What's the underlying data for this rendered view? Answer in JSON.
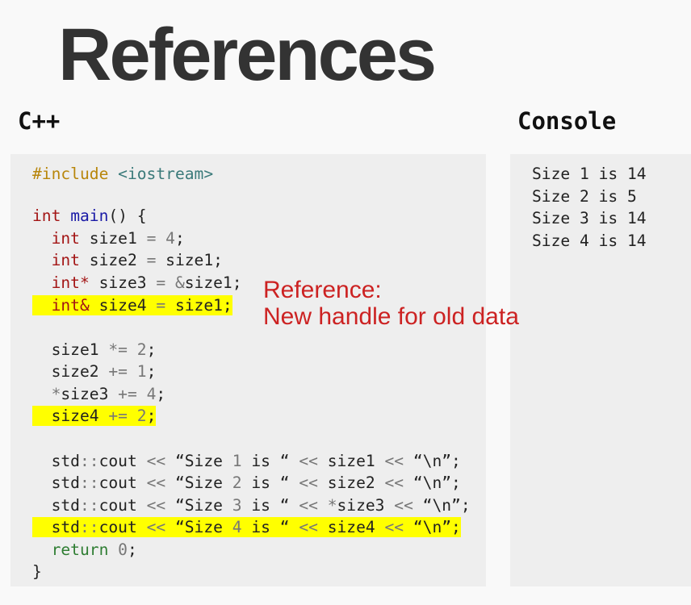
{
  "title": "References",
  "code_label": "C++",
  "console_label": "Console",
  "code": {
    "l1": {
      "a": "#include",
      "b": " ",
      "c": "<iostream>"
    },
    "l3": {
      "a": "int",
      "b": " ",
      "c": "main",
      "d": "() {"
    },
    "l4": {
      "a": "  ",
      "b": "int",
      "c": " size1 ",
      "d": "=",
      "e": " ",
      "f": "4",
      "g": ";"
    },
    "l5": {
      "a": "  ",
      "b": "int",
      "c": " size2 ",
      "d": "=",
      "e": " size1;"
    },
    "l6": {
      "a": "  ",
      "b": "int*",
      "c": " size3 ",
      "d": "=",
      "e": " ",
      "f": "&",
      "g": "size1;"
    },
    "l7": {
      "a": "  ",
      "b": "int&",
      "c": " size4 ",
      "d": "=",
      "e": " size1;"
    },
    "l9": {
      "a": "  size1 ",
      "b": "*=",
      "c": " ",
      "d": "2",
      "e": ";"
    },
    "l10": {
      "a": "  size2 ",
      "b": "+=",
      "c": " ",
      "d": "1",
      "e": ";"
    },
    "l11": {
      "a": "  ",
      "b": "*",
      "c": "size3 ",
      "d": "+=",
      "e": " ",
      "f": "4",
      "g": ";"
    },
    "l12": {
      "a": "  size4 ",
      "b": "+=",
      "c": " ",
      "d": "2",
      "e": ";"
    },
    "l14": {
      "a": "  std",
      "b": "::",
      "c": "cout ",
      "d": "<<",
      "e": " “Size ",
      "f": "1",
      "g": " is “ ",
      "h": "<<",
      "i": " size1 ",
      "j": "<<",
      "k": " “\\n”;"
    },
    "l15": {
      "a": "  std",
      "b": "::",
      "c": "cout ",
      "d": "<<",
      "e": " “Size ",
      "f": "2",
      "g": " is “ ",
      "h": "<<",
      "i": " size2 ",
      "j": "<<",
      "k": " “\\n”;"
    },
    "l16": {
      "a": "  std",
      "b": "::",
      "c": "cout ",
      "d": "<<",
      "e": " “Size ",
      "f": "3",
      "g": " is “ ",
      "h": "<<",
      "i": " ",
      "j": "*",
      "k": "size3 ",
      "l": "<<",
      "m": " “\\n”;"
    },
    "l17": {
      "a": "  std",
      "b": "::",
      "c": "cout ",
      "d": "<<",
      "e": " “Size ",
      "f": "4",
      "g": " is “ ",
      "h": "<<",
      "i": " size4 ",
      "j": "<<",
      "k": " “\\n”;"
    },
    "l18": {
      "a": "  ",
      "b": "return",
      "c": " ",
      "d": "0",
      "e": ";"
    },
    "l19": {
      "a": "}"
    }
  },
  "console": [
    "Size 1 is 14",
    "Size 2 is 5",
    "Size 3 is 14",
    "Size 4 is 14"
  ],
  "annotation": {
    "line1": "Reference:",
    "line2": "New handle for old data"
  },
  "colors": {
    "highlight": "#ffff00",
    "annotation": "#cc2222",
    "panel": "#eeeeee",
    "background": "#f9f9f9"
  }
}
